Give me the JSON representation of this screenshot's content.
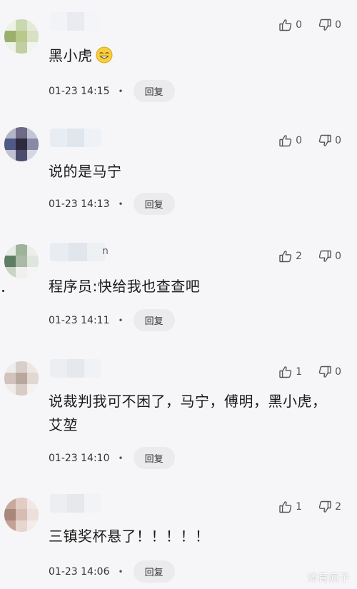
{
  "comments": [
    {
      "text": "黑小虎",
      "has_emoji": true,
      "emoji_name": "grinning-face-icon",
      "timestamp": "01-23 14:15",
      "reply_label": "回复",
      "likes": "0",
      "dislikes": "0",
      "name_suffix": "",
      "avatar_colors": [
        "#eef2e6",
        "#c9d8b0",
        "#e4ead8",
        "#9bb06d",
        "#b9c98c",
        "#d8e1c3",
        "#eef1e6",
        "#c2cfa2",
        "#f3f4ee"
      ]
    },
    {
      "text": "说的是马宁",
      "has_emoji": false,
      "timestamp": "01-23 14:13",
      "reply_label": "回复",
      "likes": "0",
      "dislikes": "0",
      "name_suffix": "",
      "avatar_colors": [
        "#b3b6c8",
        "#6f6a86",
        "#c4c6d6",
        "#505a86",
        "#2d2a3e",
        "#8789a6",
        "#c0c2d2",
        "#4b4c6e",
        "#d6d7e2"
      ]
    },
    {
      "text": "程序员:快给我也查查吧",
      "has_emoji": false,
      "timestamp": "01-23 14:11",
      "reply_label": "回复",
      "likes": "2",
      "dislikes": "0",
      "name_suffix": "n",
      "avatar_colors": [
        "#e6ece4",
        "#9fb39a",
        "#eaefe8",
        "#5f7d62",
        "#a9b9a6",
        "#dfe6dd",
        "#c9d3c6",
        "#eef1ec",
        "#f4f6f3"
      ]
    },
    {
      "text": "说裁判我可不困了，马宁，傅明，黑小虎，艾堃",
      "has_emoji": false,
      "timestamp": "01-23 14:10",
      "reply_label": "回复",
      "likes": "1",
      "dislikes": "0",
      "name_suffix": "",
      "avatar_colors": [
        "#f0ecea",
        "#d9cfca",
        "#ece7e4",
        "#d2c4bd",
        "#b9a79d",
        "#e1d8d3",
        "#efebe8",
        "#d8ccc6",
        "#f4f1ef"
      ]
    },
    {
      "text": "三镇奖杯悬了！！！！！",
      "has_emoji": false,
      "timestamp": "01-23 14:06",
      "reply_label": "回复",
      "likes": "1",
      "dislikes": "2",
      "name_suffix": "",
      "avatar_colors": [
        "#c9a89e",
        "#e2cdc6",
        "#f1e8e5",
        "#a9877c",
        "#d7bcb3",
        "#ece0dc",
        "#c3a297",
        "#e6d6d0",
        "#f3ece9"
      ]
    }
  ],
  "watermark": "体育疯子",
  "icons": {
    "like": "thumbs-up-icon",
    "dislike": "thumbs-down-icon"
  }
}
